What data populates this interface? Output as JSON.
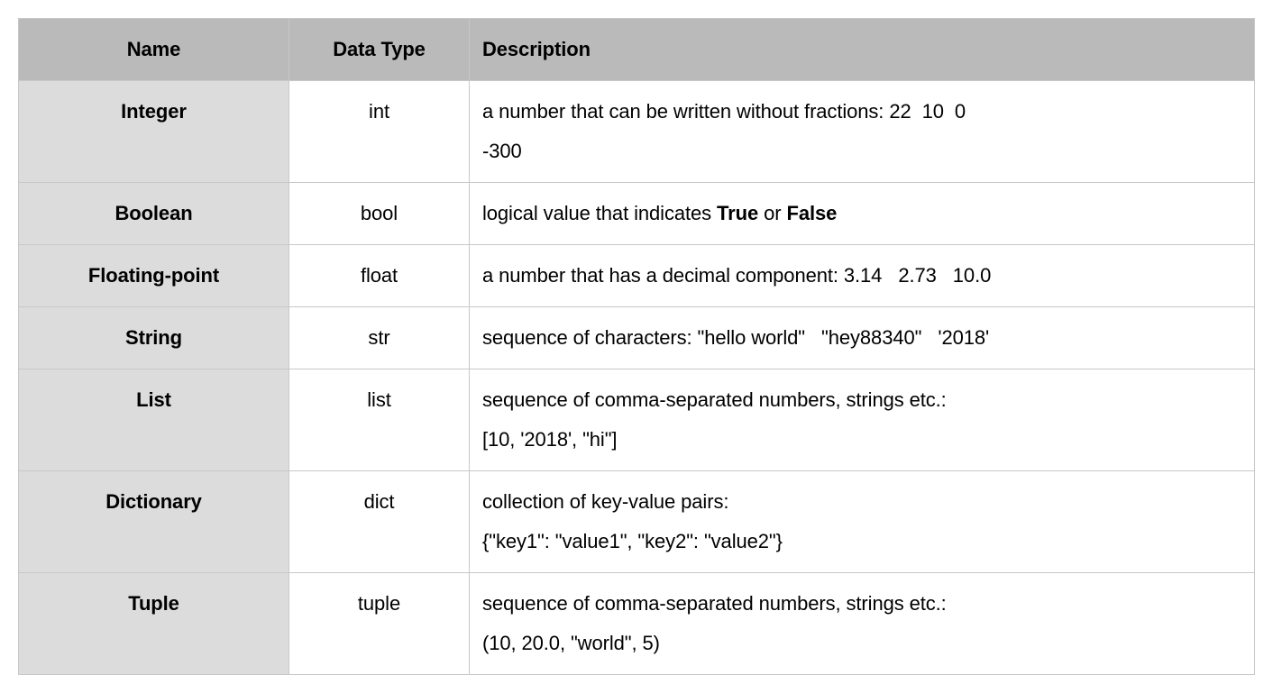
{
  "headers": {
    "name": "Name",
    "type": "Data Type",
    "desc": "Description"
  },
  "rows": [
    {
      "name": "Integer",
      "type": "int",
      "desc_html": "a number that can be written without fractions: 22&nbsp;&nbsp;10&nbsp;&nbsp;0<br>-300"
    },
    {
      "name": "Boolean",
      "type": "bool",
      "desc_html": "logical value that indicates <b class=\"inline-bold\">True</b> or <b class=\"inline-bold\">False</b>"
    },
    {
      "name": "Floating-point",
      "type": "float",
      "desc_html": "a number that has a decimal component: 3.14&nbsp;&nbsp;&nbsp;2.73&nbsp;&nbsp;&nbsp;10.0"
    },
    {
      "name": "String",
      "type": "str",
      "desc_html": "sequence of characters: \"hello world\"&nbsp;&nbsp;&nbsp;\"hey88340\"&nbsp;&nbsp;&nbsp;'2018'"
    },
    {
      "name": "List",
      "type": "list",
      "desc_html": "sequence of comma-separated numbers, strings etc.:<br>[10, '2018', \"hi\"]"
    },
    {
      "name": "Dictionary",
      "type": "dict",
      "desc_html": "collection of key-value pairs:<br>{\"key1\": \"value1\", \"key2\": \"value2\"}"
    },
    {
      "name": "Tuple",
      "type": "tuple",
      "desc_html": "sequence of comma-separated numbers, strings etc.:<br>(10, 20.0, \"world\", 5)"
    }
  ]
}
